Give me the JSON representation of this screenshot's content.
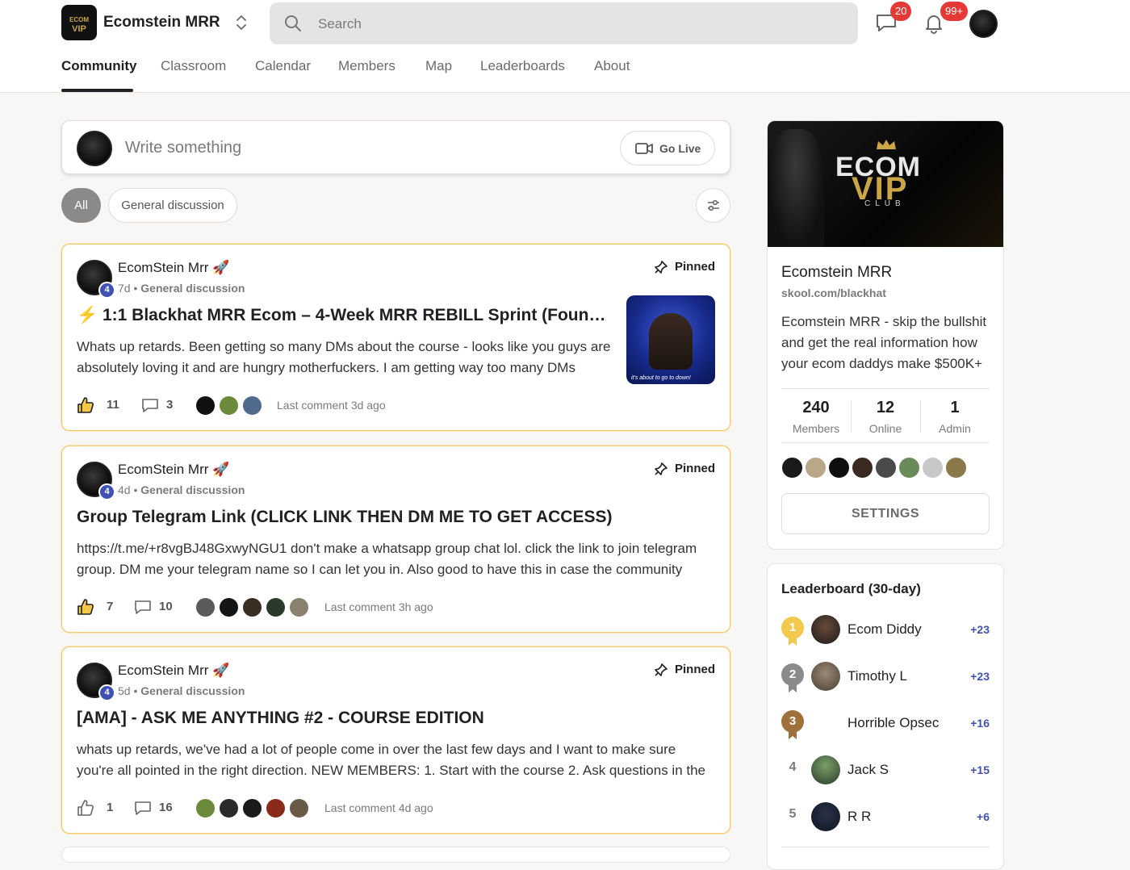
{
  "header": {
    "brand_name": "Ecomstein MRR",
    "logo_text_top": "ECOM",
    "logo_text_bottom": "VIP",
    "search_placeholder": "Search",
    "chat_badge": "20",
    "notif_badge": "99+"
  },
  "tabs": [
    "Community",
    "Classroom",
    "Calendar",
    "Members",
    "Map",
    "Leaderboards",
    "About"
  ],
  "composer": {
    "placeholder": "Write something",
    "go_live": "Go Live"
  },
  "filters": {
    "all": "All",
    "general": "General discussion"
  },
  "posts": [
    {
      "author": "EcomStein Mrr 🚀",
      "level": "4",
      "age": "7d",
      "category": "General discussion",
      "pinned": "Pinned",
      "title": "⚡ 1:1 Blackhat MRR Ecom – 4-Week MRR REBILL Sprint (Foundin...",
      "body": "Whats up retards. Been getting so many DMs about the course - looks like you guys are absolutely loving it and are hungry motherfuckers. I am getting way too many DMs",
      "likes": "11",
      "comments": "3",
      "last_comment": "Last comment 3d ago",
      "thumb_caption": "it's about to go to down!"
    },
    {
      "author": "EcomStein Mrr 🚀",
      "level": "4",
      "age": "4d",
      "category": "General discussion",
      "pinned": "Pinned",
      "title": "Group Telegram Link (CLICK LINK THEN DM ME TO GET ACCESS)",
      "body": "https://t.me/+r8vgBJ48GxwyNGU1 don't make a whatsapp group chat lol. click the link to join telegram group. DM me your telegram name so I can let you in. Also good to have this in case the community",
      "likes": "7",
      "comments": "10",
      "last_comment": "Last comment 3h ago"
    },
    {
      "author": "EcomStein Mrr 🚀",
      "level": "4",
      "age": "5d",
      "category": "General discussion",
      "pinned": "Pinned",
      "title": "[AMA] - ASK ME ANYTHING #2 - COURSE EDITION",
      "body": "whats up retards, we've had a lot of people come in over the last few days and I want to make sure you're all pointed in the right direction. NEW MEMBERS: 1. Start with the course 2. Ask questions in the",
      "likes": "1",
      "comments": "16",
      "last_comment": "Last comment 4d ago"
    }
  ],
  "group": {
    "cover_ecom": "ECOM",
    "cover_vip": "VIP",
    "cover_club": "CLUB",
    "name": "Ecomstein MRR",
    "url": "skool.com/blackhat",
    "description": "Ecomstein MRR - skip the bullshit and get the real information how your ecom daddys make $500K+",
    "members_count": "240",
    "members_label": "Members",
    "online_count": "12",
    "online_label": "Online",
    "admin_count": "1",
    "admin_label": "Admin",
    "settings": "SETTINGS"
  },
  "leaderboard": {
    "title": "Leaderboard (30-day)",
    "rows": [
      {
        "rank": "1",
        "name": "Ecom Diddy",
        "points": "+23"
      },
      {
        "rank": "2",
        "name": "Timothy L",
        "points": "+23"
      },
      {
        "rank": "3",
        "name": "Horrible Opsec",
        "points": "+16"
      },
      {
        "rank": "4",
        "name": "Jack S",
        "points": "+15"
      },
      {
        "rank": "5",
        "name": "R R",
        "points": "+6"
      }
    ]
  },
  "colors": {
    "accent": "#3f51b5",
    "badge": "#e53935",
    "pinned_border": "#f3c76b",
    "gold": "#f2c94c",
    "silver": "#8a8a8a",
    "bronze": "#a0703a"
  }
}
